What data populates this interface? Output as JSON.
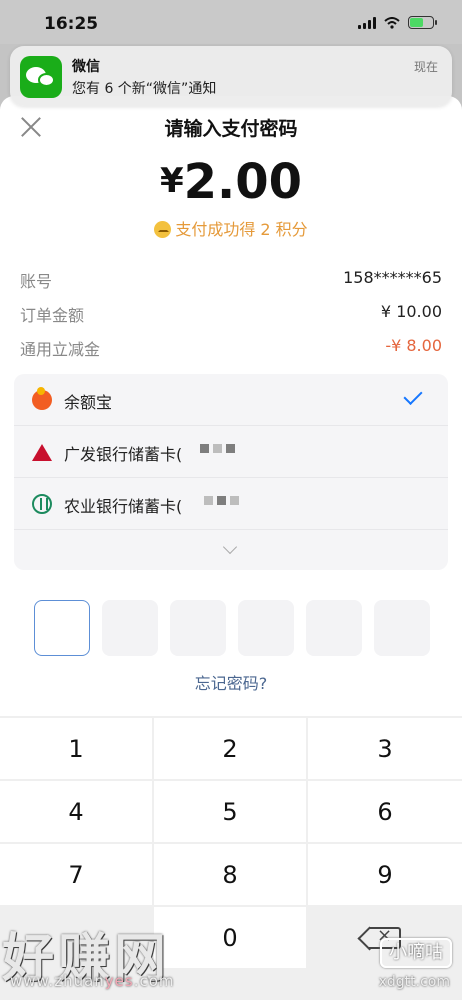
{
  "status_bar": {
    "time": "16:25"
  },
  "notification": {
    "app": "微信",
    "message": "您有 6 个新“微信”通知",
    "time": "现在"
  },
  "sheet": {
    "title": "请输入支付密码",
    "currency": "¥",
    "amount": "2.00",
    "points_text": "支付成功得 2 积分",
    "details": [
      {
        "label": "账号",
        "value": "158******65"
      },
      {
        "label": "订单金额",
        "value": "¥ 10.00"
      },
      {
        "label": "通用立减金",
        "value": "-¥ 8.00"
      }
    ]
  },
  "payment_methods": [
    {
      "name": "余额宝",
      "selected": true
    },
    {
      "name": "广发银行储蓄卡(",
      "selected": false
    },
    {
      "name": "农业银行储蓄卡(",
      "selected": false
    }
  ],
  "forgot_password": "忘记密码?",
  "keypad": {
    "keys": [
      "1",
      "2",
      "3",
      "4",
      "5",
      "6",
      "7",
      "8",
      "9",
      "0"
    ]
  },
  "watermarks": {
    "left": "好赚网",
    "left_url_pre": "www.zhuan",
    "left_url_hl": "yes",
    "left_url_post": ".com",
    "right": "小嘀咕",
    "right_url": "xdgtt.com"
  },
  "colors": {
    "accent_blue": "#1677ff",
    "discount_orange": "#e5663e",
    "points_orange": "#e59a3a",
    "wechat_green": "#1aad19"
  }
}
